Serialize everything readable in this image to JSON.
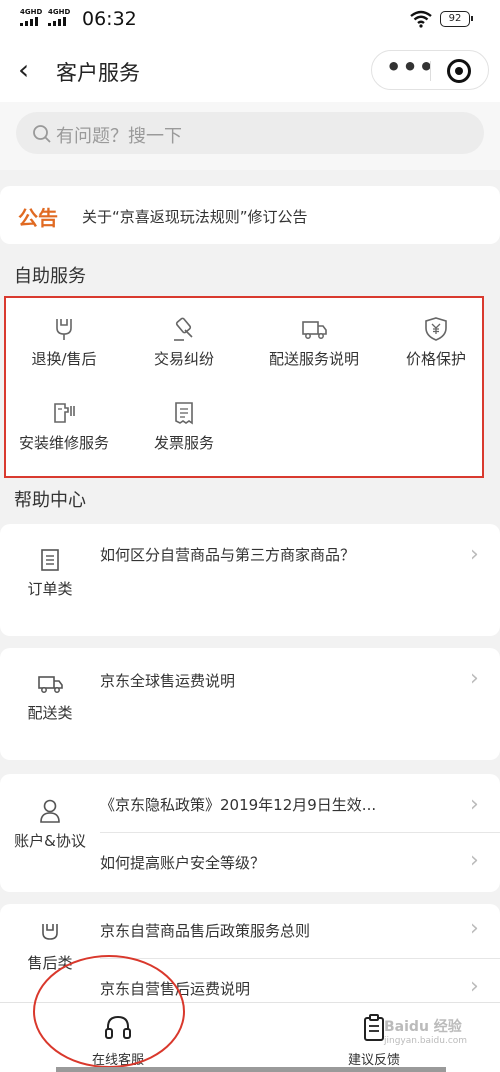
{
  "status_bar": {
    "signal_1": "4GHD",
    "signal_2": "4GHD",
    "time": "06:32",
    "battery": "92"
  },
  "nav": {
    "back_icon": "chevron-left-icon",
    "title": "客户服务",
    "more_icon": "more-dots-icon",
    "close_icon": "target-icon"
  },
  "search": {
    "placeholder": "有问题？搜一下"
  },
  "notice": {
    "tag": "公告",
    "text": "关于“京喜返现玩法规则”修订公告"
  },
  "self_service": {
    "title": "自助服务",
    "items": [
      {
        "label": "退换/售后",
        "icon": "wrench-icon"
      },
      {
        "label": "交易纠纷",
        "icon": "gavel-icon"
      },
      {
        "label": "配送服务说明",
        "icon": "truck-icon"
      },
      {
        "label": "价格保护",
        "icon": "yen-shield-icon"
      },
      {
        "label": "安装维修服务",
        "icon": "install-icon"
      },
      {
        "label": "发票服务",
        "icon": "invoice-icon"
      }
    ]
  },
  "help_center": {
    "title": "帮助中心",
    "categories": [
      {
        "label": "订单类",
        "icon": "document-icon",
        "questions": [
          "如何区分自营商品与第三方商家商品？"
        ]
      },
      {
        "label": "配送类",
        "icon": "truck-icon",
        "questions": [
          "京东全球售运费说明"
        ]
      },
      {
        "label": "账户&协议",
        "icon": "person-icon",
        "questions": [
          "《京东隐私政策》2019年12月9日生效...",
          "如何提高账户安全等级？"
        ]
      },
      {
        "label": "售后类",
        "icon": "wrench-icon",
        "questions": [
          "京东自营商品售后政策服务总则",
          "京东自营售后运费说明"
        ]
      }
    ]
  },
  "tab_bar": {
    "online_service": "在线客服",
    "feedback": "建议反馈"
  },
  "watermark": {
    "brand": "Baidu 经验",
    "site": "jingyan.baidu.com"
  },
  "colors": {
    "accent": "#e06a22",
    "highlight_border": "#d93a2f",
    "background": "#f2f2f2"
  }
}
